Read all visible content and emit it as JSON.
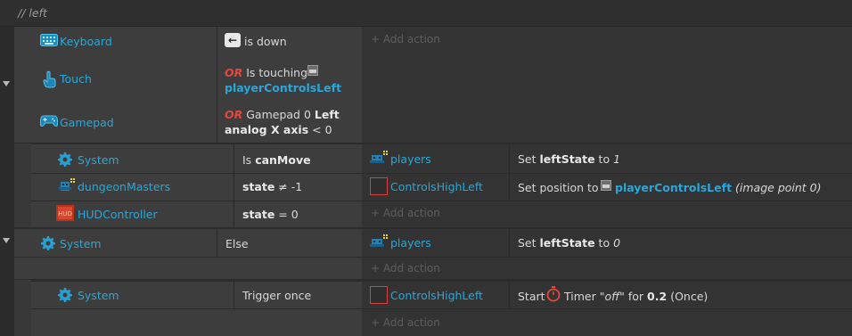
{
  "comment": "//  left",
  "add_action": "+ Add action",
  "blocks": {
    "b1": {
      "c1": {
        "object": "Keyboard",
        "key": "←",
        "text": "is down"
      },
      "c2": {
        "object": "Touch",
        "or": "OR",
        "text": "Is touching",
        "target": "playerControlsLeft"
      },
      "c3": {
        "object": "Gamepad",
        "or": "OR",
        "text1": "Gamepad 0",
        "bold1": "Left",
        "bold2": "analog X axis",
        "text2": "< 0"
      }
    },
    "b2": {
      "c1": {
        "object": "System",
        "pre": "Is",
        "bold": "canMove"
      },
      "c2": {
        "object": "dungeonMasters",
        "bold": "state",
        "text": "≠ -1"
      },
      "c3": {
        "object": "HUDController",
        "bold": "state",
        "text": "= 0"
      },
      "a1": {
        "object": "players",
        "pre": "Set",
        "bold": "leftState",
        "mid": "to",
        "val": "1"
      },
      "a2": {
        "object": "ControlsHighLeft",
        "pre": "Set position to",
        "target": "playerControlsLeft",
        "post": "(image point 0)"
      }
    },
    "b3": {
      "c1": {
        "object": "System",
        "text": "Else"
      },
      "a1": {
        "object": "players",
        "pre": "Set",
        "bold": "leftState",
        "mid": "to",
        "val": "0"
      }
    },
    "b4": {
      "c1": {
        "object": "System",
        "text": "Trigger once"
      },
      "a1": {
        "object": "ControlsHighLeft",
        "pre": "Start",
        "mid": "Timer",
        "name": "\"off\"",
        "for": "for",
        "val": "0.2",
        "post": "(Once)"
      }
    }
  },
  "colors": {
    "object": "#2aa7d8",
    "or": "#e2483d",
    "background": "#2b2b2b"
  }
}
